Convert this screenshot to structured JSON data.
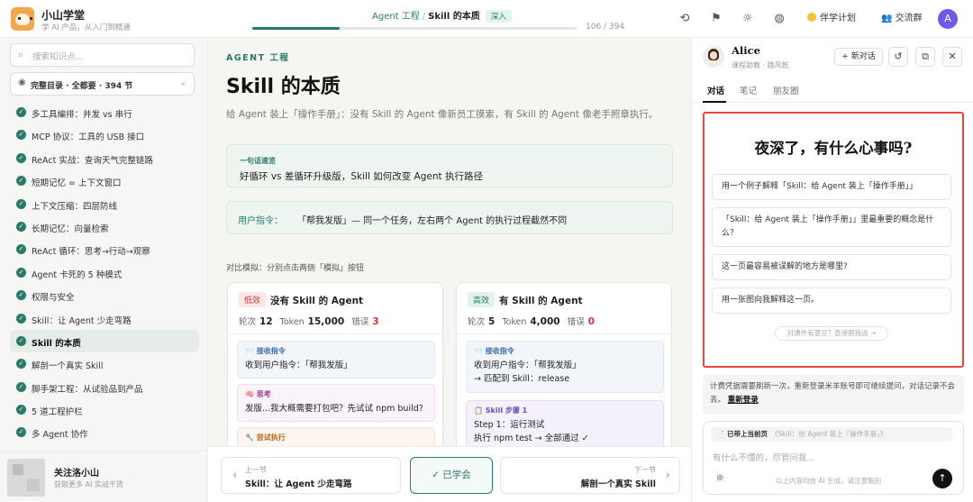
{
  "header": {
    "brand_name": "小山学堂",
    "brand_sub": "学 AI 产品，从入门到精通",
    "crumb_section": "Agent 工程",
    "crumb_sep": "/",
    "crumb_current": "Skill 的本质",
    "crumb_tag": "深入",
    "progress_count": "106 / 394",
    "progress_fraction": 0.27,
    "companion_plan": "伴学计划",
    "community": "交流群",
    "user_initial": "A",
    "icons": [
      "share-icon",
      "bookmark-icon",
      "sun-icon",
      "globe-icon",
      "users-icon",
      "user-icon"
    ]
  },
  "sidebar": {
    "search_placeholder": "搜索知识点...",
    "toc_selector": "完整目录 · 全都要 · 394 节",
    "items": [
      {
        "label": "多工具编排：并发 vs 串行",
        "active": false
      },
      {
        "label": "MCP 协议：工具的 USB 接口",
        "active": false
      },
      {
        "label": "ReAct 实战：查询天气完整链路",
        "active": false
      },
      {
        "label": "短期记忆 = 上下文窗口",
        "active": false
      },
      {
        "label": "上下文压缩：四层防线",
        "active": false
      },
      {
        "label": "长期记忆：向量检索",
        "active": false
      },
      {
        "label": "ReAct 循环：思考→行动→观察",
        "active": false
      },
      {
        "label": "Agent 卡死的 5 种模式",
        "active": false
      },
      {
        "label": "权限与安全",
        "active": false
      },
      {
        "label": "Skill：让 Agent 少走弯路",
        "active": false
      },
      {
        "label": "Skill 的本质",
        "active": true
      },
      {
        "label": "解剖一个真实 Skill",
        "active": false
      },
      {
        "label": "脚手架工程：从试验品到产品",
        "active": false
      },
      {
        "label": "5 道工程护栏",
        "active": false
      },
      {
        "label": "多 Agent 协作",
        "active": false
      }
    ],
    "footer_title": "关注洛小山",
    "footer_sub": "获取更多 AI 实战干货"
  },
  "main": {
    "kicker": "AGENT 工程",
    "title": "Skill 的本质",
    "subtitle": "给 Agent 装上「操作手册」：没有 Skill 的 Agent 像新员工摸索，有 Skill 的 Agent 像老手照章执行。",
    "summary_label": "一句话速览",
    "summary_text": "好循环 vs 差循环升级版，Skill 如何改变 Agent 执行路径",
    "command_label": "用户指令：",
    "command_text": "「帮我发版」— 同一个任务，左右两个 Agent 的执行过程截然不同",
    "compare_hint": "对比模拟：分别点击两侧「模拟」按钮",
    "cards": [
      {
        "badge": "低效",
        "title": "没有 Skill 的 Agent",
        "rounds_label": "轮次",
        "rounds": "12",
        "tokens_label": "Token",
        "tokens": "15,000",
        "errors_label": "错误",
        "errors": "3",
        "steps": [
          {
            "label": "📨 接收指令",
            "lines": [
              "收到用户指令：「帮我发版」"
            ]
          },
          {
            "label": "🧠 思考",
            "lines": [
              "发版...我大概需要打包吧？先试试 npm build?"
            ]
          },
          {
            "label": "🔧 尝试执行",
            "lines": [
              ""
            ]
          }
        ]
      },
      {
        "badge": "高效",
        "title": "有 Skill 的 Agent",
        "rounds_label": "轮次",
        "rounds": "5",
        "tokens_label": "Token",
        "tokens": "4,000",
        "errors_label": "错误",
        "errors": "0",
        "steps": [
          {
            "label": "📨 接收指令",
            "lines": [
              "收到用户指令：「帮我发版」",
              "→ 匹配到 Skill：release"
            ]
          },
          {
            "label": "📋 Skill 步骤 1",
            "lines": [
              "Step 1：运行测试",
              "执行 npm test → 全部通过 ✓"
            ]
          }
        ]
      }
    ],
    "prev_label": "上一节",
    "prev_title": "Skill：让 Agent 少走弯路",
    "learned": "✓ 已学会",
    "next_label": "下一节",
    "next_title": "解剖一个真实 Skill"
  },
  "panel": {
    "tutor_name": "Alice",
    "tutor_sub": "课程助教 · 路风乾",
    "new_chat": "+ 新对话",
    "tabs": [
      "对话",
      "笔记",
      "朋友圈"
    ],
    "greeting": "夜深了，有什么心事吗?",
    "suggestions": [
      "用一个例子解释「Skill：给 Agent 装上「操作手册」」",
      "「Skill：给 Agent 装上「操作手册」」里最重要的概念是什么？",
      "这一页最容易被误解的地方是哪里?",
      "用一张图向我解释这一页。"
    ],
    "feedback": "对课件有意见？直接跟我说 →",
    "notice_text": "计费凭据需要刷新一次，重新登录米羊账号即可继续提问，对话记录不会丢。",
    "relogin": "重新登录",
    "context_label": "📄 已带上当前页",
    "context_ref": "《Skill：给 Agent 装上「操作手册」》",
    "input_placeholder": "有什么不懂的，尽管问我...",
    "disclaimer": "以上内容均由 AI 生成，请注意甄别"
  }
}
